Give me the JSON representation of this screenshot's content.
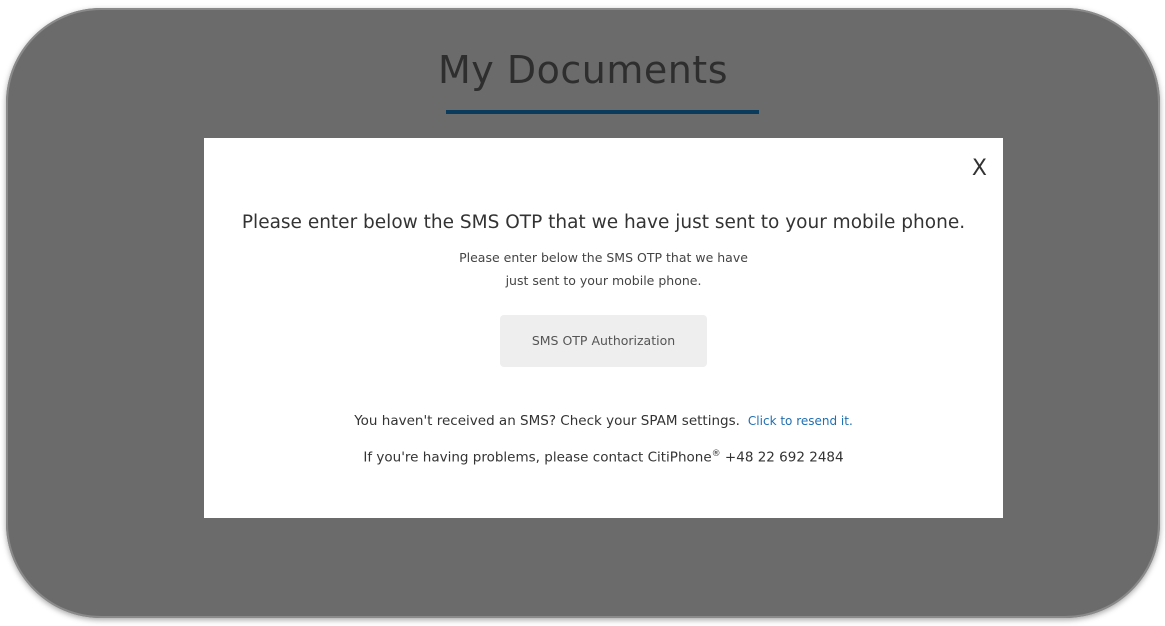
{
  "page": {
    "title": "My Documents",
    "accent_color": "#0a3a5c",
    "backdrop_color": "#6b6b6b"
  },
  "modal": {
    "close_label": "X",
    "heading": "Please enter below the SMS OTP that we have just sent to your mobile phone.",
    "subtext_line1": "Please enter below the SMS OTP that we have",
    "subtext_line2": "just sent to your mobile phone.",
    "otp_button_label": "SMS OTP Authorization",
    "spam_text": "You haven't received an SMS? Check your SPAM settings.",
    "resend_link": "Click to resend it.",
    "contact_text": "If you're having problems, please contact CitiPhone",
    "contact_registered": "®",
    "contact_phone": "+48 22 692 2484",
    "link_color": "#1f6fb3"
  }
}
